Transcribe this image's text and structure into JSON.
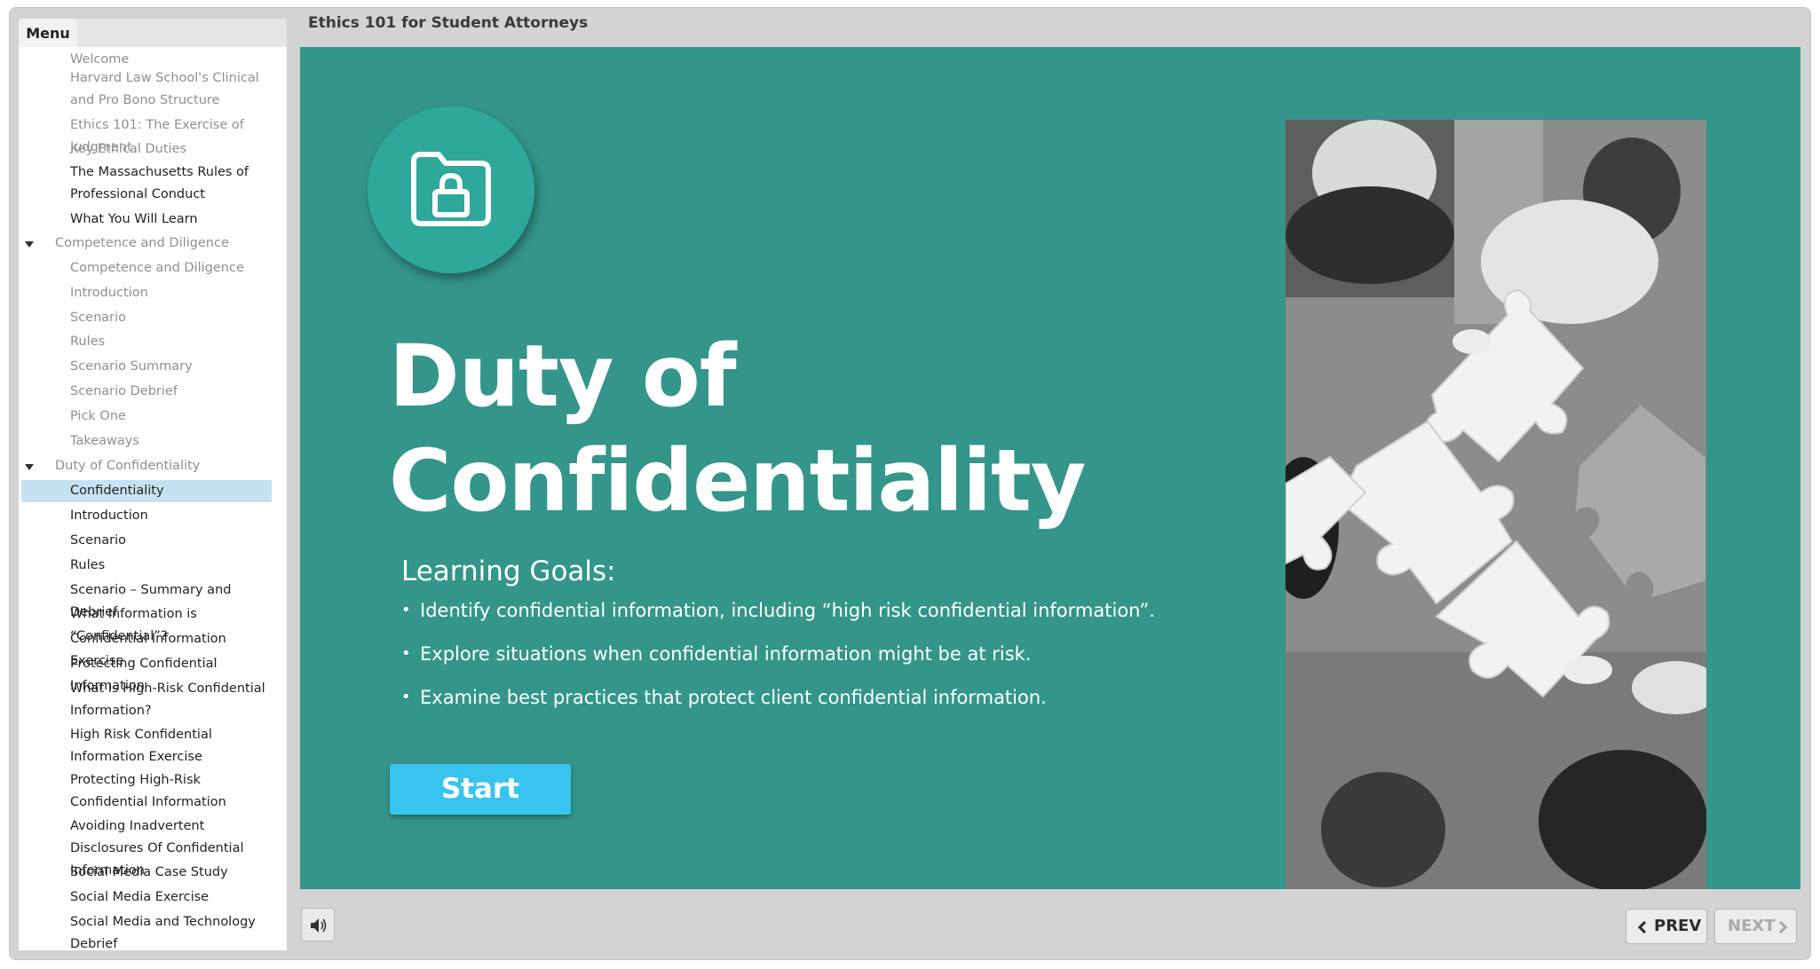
{
  "course_title": "Ethics 101 for Student Attorneys",
  "sidebar": {
    "menu_tab_label": "Menu",
    "items": [
      {
        "label": "Welcome"
      },
      {
        "label": "Harvard Law School's Clinical and Pro Bono Structure"
      },
      {
        "label": "Ethics 101: The Exercise of Judgment"
      },
      {
        "label": "Key Ethical Duties"
      },
      {
        "label": "The Massachusetts Rules of Professional Conduct"
      },
      {
        "label": "What You Will Learn"
      },
      {
        "label": "Competence and Diligence"
      },
      {
        "label": "Competence and Diligence"
      },
      {
        "label": "Introduction"
      },
      {
        "label": "Scenario"
      },
      {
        "label": "Rules"
      },
      {
        "label": "Scenario Summary"
      },
      {
        "label": "Scenario Debrief"
      },
      {
        "label": "Pick One"
      },
      {
        "label": "Takeaways"
      },
      {
        "label": "Duty of Confidentiality"
      },
      {
        "label": "Confidentiality"
      },
      {
        "label": "Introduction"
      },
      {
        "label": "Scenario"
      },
      {
        "label": "Rules"
      },
      {
        "label": "Scenario – Summary and Debrief"
      },
      {
        "label": "What Information is “Confidential”?"
      },
      {
        "label": "Confidential Information Exercise"
      },
      {
        "label": "Protecting Confidential Information"
      },
      {
        "label": "What Is High-Risk Confidential Information?"
      },
      {
        "label": "High Risk Confidential Information Exercise"
      },
      {
        "label": "Protecting High-Risk Confidential Information"
      },
      {
        "label": "Avoiding Inadvertent Disclosures Of Confidential Information"
      },
      {
        "label": "Social Media Case Study"
      },
      {
        "label": "Social Media Exercise"
      },
      {
        "label": "Social Media and Technology Debrief"
      }
    ]
  },
  "slide": {
    "icon": "folder-lock-icon",
    "title": "Duty of Confidentiality",
    "goals_heading": "Learning Goals:",
    "goals": [
      "Identify confidential information, including “high risk confidential information”.",
      "Explore situations when confidential information might be at risk.",
      "Examine best practices that protect client confidential information."
    ],
    "start_label": "Start",
    "image": "puzzle-pieces-meeting-photo"
  },
  "footer": {
    "audio_icon": "speaker-icon",
    "prev_label": "PREV",
    "next_label": "NEXT"
  },
  "colors": {
    "slide_background": "#34958a",
    "start_button": "#38c4ee",
    "selected_menu_item": "#c6e2f2",
    "visited_menu_item": "#8f8f8f"
  }
}
